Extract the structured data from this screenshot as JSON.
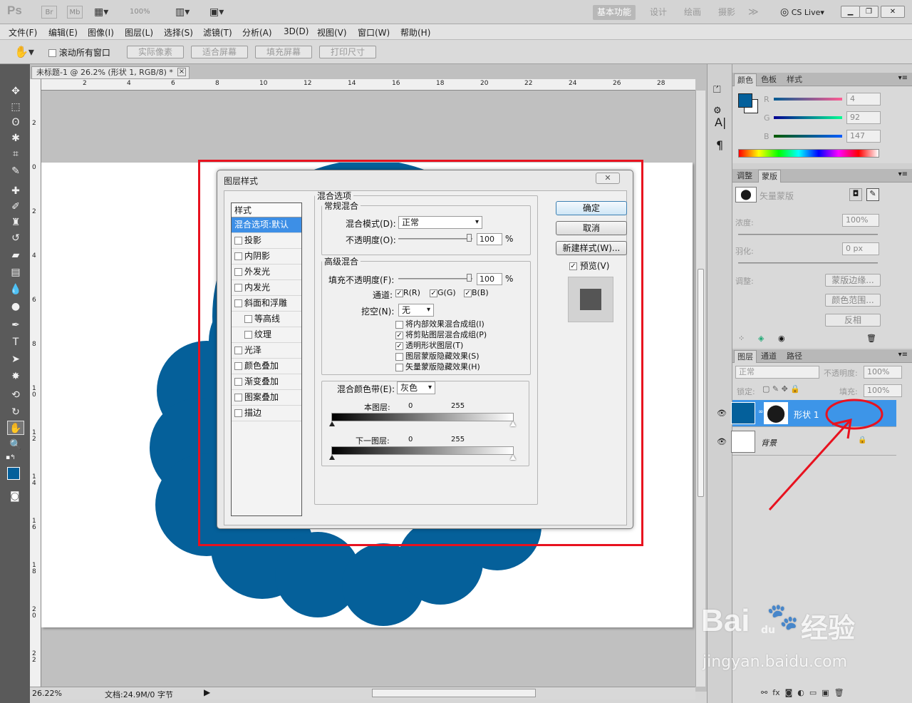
{
  "appbar": {
    "logo": "Ps",
    "br": "Br",
    "mb": "Mb",
    "zoom": "100%",
    "workspaces": [
      "基本功能",
      "设计",
      "绘画",
      "摄影"
    ],
    "more": "≫",
    "cslive": "CS Live▾"
  },
  "menu": [
    "文件(F)",
    "编辑(E)",
    "图像(I)",
    "图层(L)",
    "选择(S)",
    "滤镜(T)",
    "分析(A)",
    "3D(D)",
    "视图(V)",
    "窗口(W)",
    "帮助(H)"
  ],
  "options": {
    "scroll_all": "滚动所有窗口",
    "buttons": [
      "实际像素",
      "适合屏幕",
      "填充屏幕",
      "打印尺寸"
    ]
  },
  "doc": {
    "tab": "未标题-1 @ 26.2% (形状 1, RGB/8) *",
    "close": "×"
  },
  "ruler": {
    "h": [
      "2",
      "4",
      "6",
      "8",
      "10",
      "12",
      "14",
      "16",
      "18",
      "20",
      "22",
      "24",
      "26",
      "28"
    ],
    "v": [
      "2",
      "0",
      "2",
      "4",
      "6",
      "8",
      "1\n0",
      "1\n2",
      "1\n4",
      "1\n6",
      "1\n8",
      "2\n0",
      "2\n2"
    ]
  },
  "status": {
    "zoom": "26.22%",
    "doc": "文档:24.9M/0 字节"
  },
  "colors": {
    "fg": "#04609B",
    "shape": "#05609A",
    "highlight": "#e8121f"
  },
  "color_panel": {
    "tabs": [
      "颜色",
      "色板",
      "样式"
    ],
    "r_label": "R",
    "g_label": "G",
    "b_label": "B",
    "r": "4",
    "g": "92",
    "b": "147"
  },
  "mask_panel": {
    "tabs": [
      "调整",
      "蒙版"
    ],
    "vector_mask": "矢量蒙版",
    "density_label": "浓度:",
    "density": "100%",
    "feather_label": "羽化:",
    "feather": "0 px",
    "adjust_label": "调整:",
    "buttons": [
      "蒙版边缘...",
      "颜色范围...",
      "反相"
    ]
  },
  "layers_panel": {
    "tabs": [
      "图层",
      "通道",
      "路径"
    ],
    "mode": "正常",
    "opacity_label": "不透明度:",
    "opacity": "100%",
    "lock_label": "锁定:",
    "fill_label": "填充:",
    "fill": "100%",
    "layers": [
      {
        "name": "形状 1"
      },
      {
        "name": "背景"
      }
    ]
  },
  "dialog": {
    "title": "图层样式",
    "close": "✕",
    "styles_header": "样式",
    "styles": [
      {
        "label": "混合选项:默认",
        "selected": true,
        "check": false,
        "sub": false
      },
      {
        "label": "投影",
        "check": true,
        "sub": false
      },
      {
        "label": "内阴影",
        "check": true,
        "sub": false
      },
      {
        "label": "外发光",
        "check": true,
        "sub": false
      },
      {
        "label": "内发光",
        "check": true,
        "sub": false
      },
      {
        "label": "斜面和浮雕",
        "check": true,
        "sub": false
      },
      {
        "label": "等高线",
        "check": true,
        "sub": true
      },
      {
        "label": "纹理",
        "check": true,
        "sub": true
      },
      {
        "label": "光泽",
        "check": true,
        "sub": false
      },
      {
        "label": "颜色叠加",
        "check": true,
        "sub": false
      },
      {
        "label": "渐变叠加",
        "check": true,
        "sub": false
      },
      {
        "label": "图案叠加",
        "check": true,
        "sub": false
      },
      {
        "label": "描边",
        "check": true,
        "sub": false
      }
    ],
    "blend_options": "混合选项",
    "general_blend": "常规混合",
    "blend_mode_label": "混合模式(D):",
    "blend_mode": "正常",
    "opacity_label": "不透明度(O):",
    "opacity": "100",
    "pct": "%",
    "advanced_blend": "高级混合",
    "fill_opacity_label": "填充不透明度(F):",
    "fill_opacity": "100",
    "channels_label": "通道:",
    "channels": [
      "R(R)",
      "G(G)",
      "B(B)"
    ],
    "knockout_label": "挖空(N):",
    "knockout": "无",
    "adv_options": [
      {
        "label": "将内部效果混合成组(I)",
        "checked": false
      },
      {
        "label": "将剪贴图层混合成组(P)",
        "checked": true
      },
      {
        "label": "透明形状图层(T)",
        "checked": true
      },
      {
        "label": "图层蒙版隐藏效果(S)",
        "checked": false
      },
      {
        "label": "矢量蒙版隐藏效果(H)",
        "checked": false
      }
    ],
    "blend_if_label": "混合颜色带(E):",
    "blend_if": "灰色",
    "this_layer": "本图层:",
    "under_layer": "下一图层:",
    "low": "0",
    "high": "255",
    "ok": "确定",
    "cancel": "取消",
    "new_style": "新建样式(W)...",
    "preview": "预览(V)"
  },
  "watermark": {
    "brand": "Bai",
    "brand2": "du",
    "jy": "经验",
    "url": "jingyan.baidu.com"
  }
}
